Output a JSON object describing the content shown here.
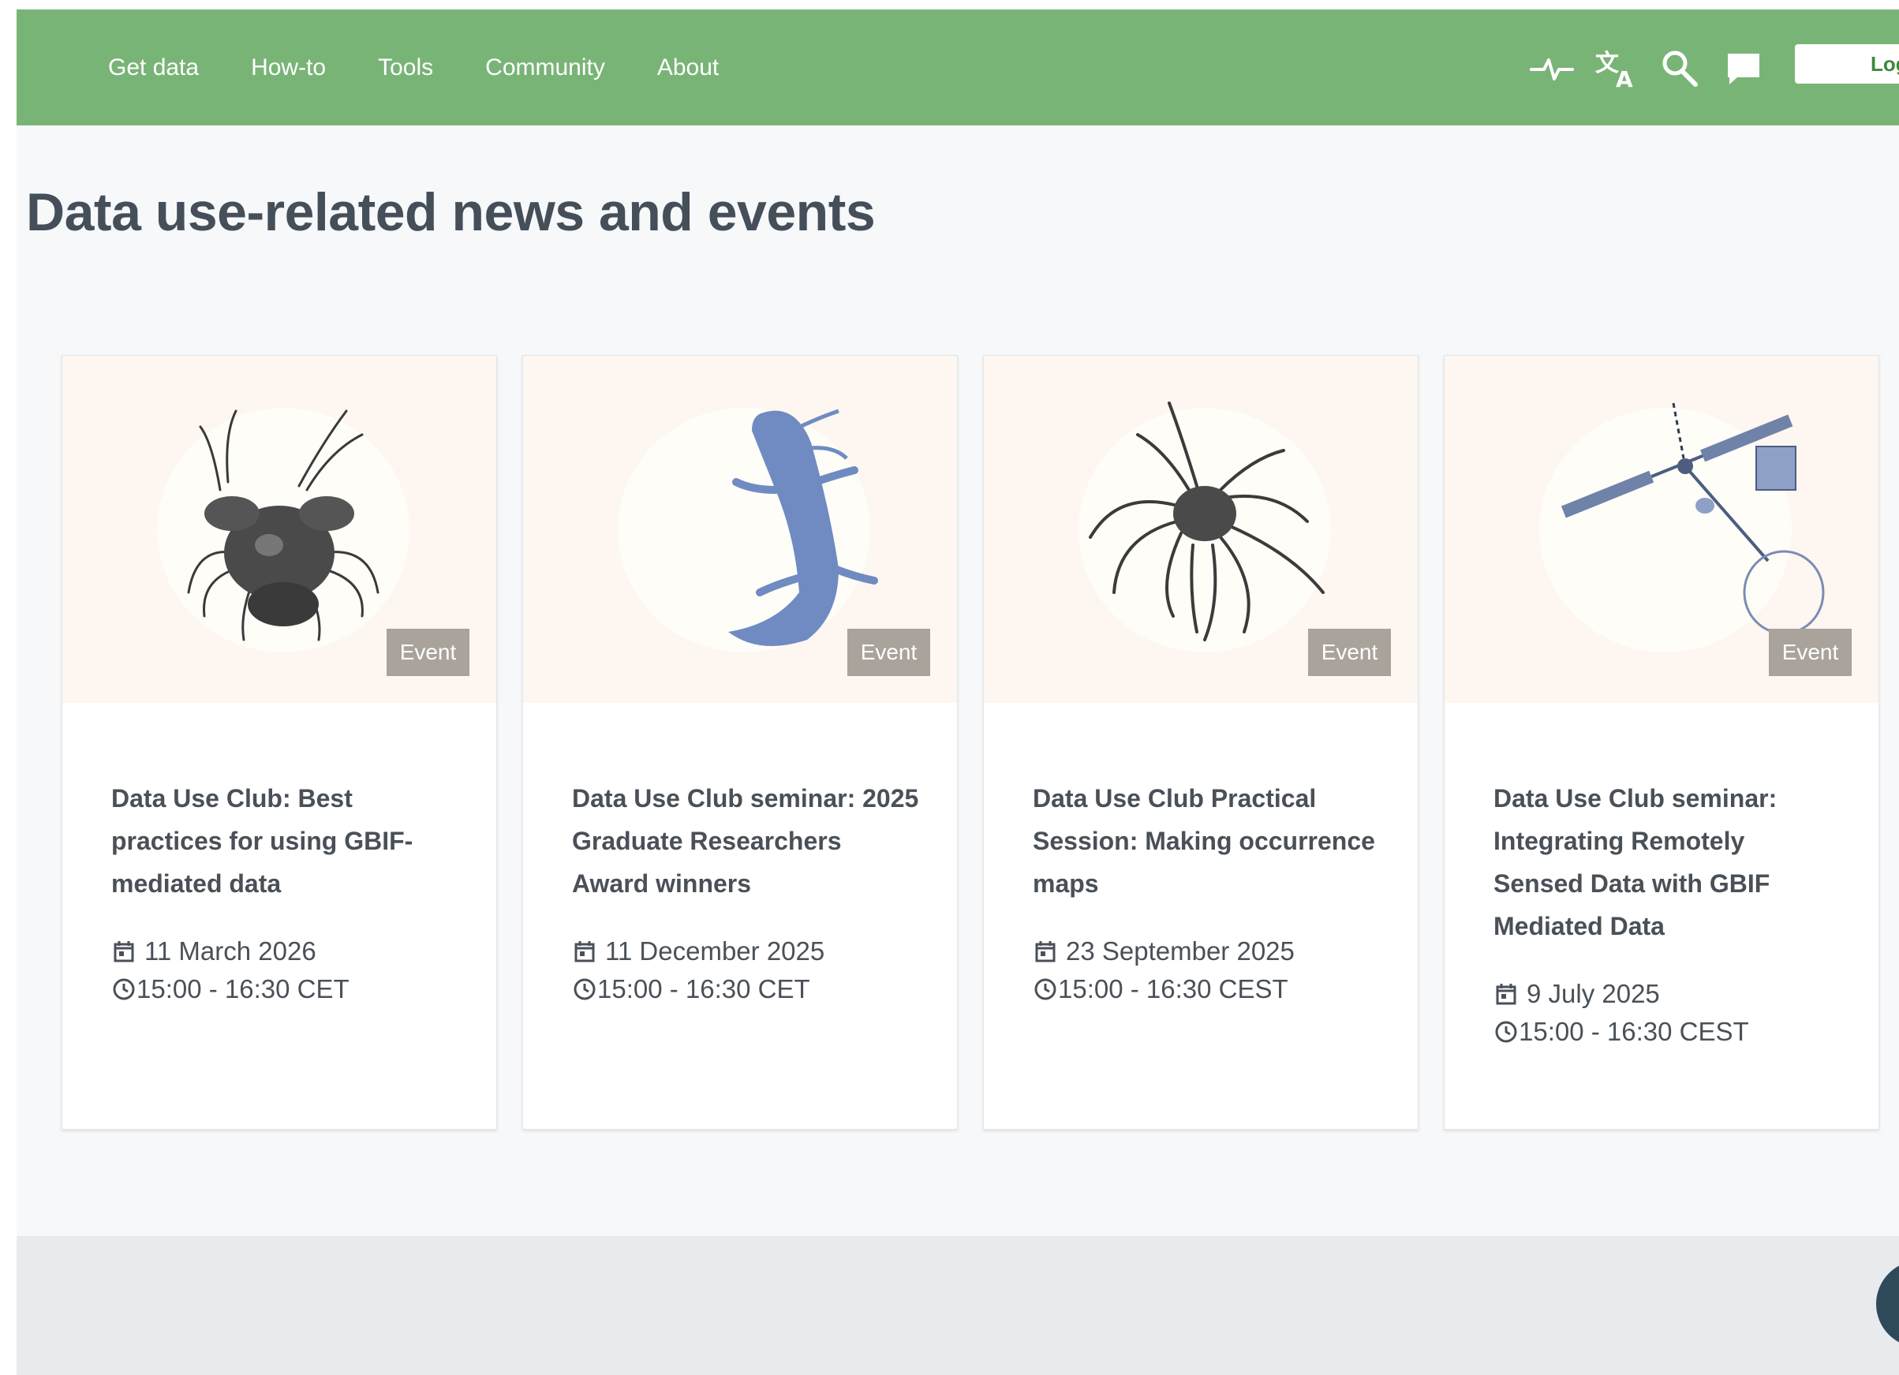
{
  "nav": {
    "links": [
      "Get data",
      "How-to",
      "Tools",
      "Community",
      "About"
    ],
    "icons": [
      "activity-icon",
      "translate-icon",
      "search-icon",
      "feedback-icon"
    ],
    "login_label": "Login"
  },
  "page": {
    "title": "Data use-related news and events"
  },
  "cards": [
    {
      "image": "coconut-crab-illustration",
      "badge": "Event",
      "title": "Data Use Club: Best practices for using GBIF-mediated data",
      "date": "11 March 2026",
      "time": "15:00 - 16:30 CET"
    },
    {
      "image": "axolotl-illustration",
      "badge": "Event",
      "title": "Data Use Club seminar: 2025 Graduate Researchers Award winners",
      "date": "11 December 2025",
      "time": "15:00 - 16:30 CET"
    },
    {
      "image": "spider-crab-illustration",
      "badge": "Event",
      "title": "Data Use Club Practical Session: Making occurrence maps",
      "date": "23 September 2025",
      "time": "15:00 - 16:30 CEST"
    },
    {
      "image": "satellite-illustration",
      "badge": "Event",
      "title": "Data Use Club seminar: Integrating Remotely Sensed Data with GBIF Mediated Data",
      "date": "9 July 2025",
      "time": "15:00 - 16:30 CEST"
    }
  ],
  "colors": {
    "navbar": "#79b477",
    "card_media_bg": "#fdf6f1",
    "badge_bg": "#a9a39b",
    "title_text": "#454f59",
    "footer_bg": "#e8ebee"
  }
}
